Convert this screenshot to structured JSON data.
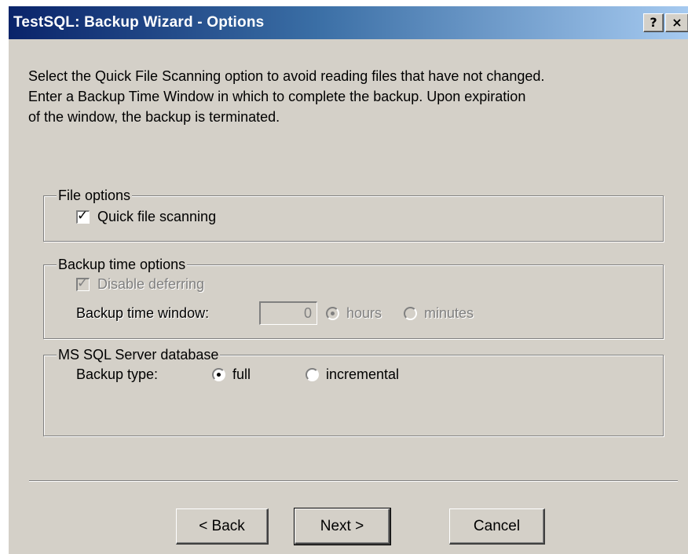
{
  "window": {
    "title": "TestSQL: Backup Wizard - Options",
    "help_glyph": "?",
    "close_glyph": "×"
  },
  "description": {
    "line1": "Select the Quick File Scanning option to avoid reading files that have not changed.",
    "line2": "Enter a Backup Time Window in which to complete the backup. Upon expiration",
    "line3": "of the window, the backup is terminated."
  },
  "file_options": {
    "legend": "File options",
    "quick_scan_label": "Quick file scanning",
    "quick_scan_checked": true
  },
  "backup_time_options": {
    "legend": "Backup time options",
    "disable_deferring_label": "Disable deferring",
    "disable_deferring_checked": true,
    "disabled": true,
    "window_label": "Backup time window:",
    "window_value": "0",
    "unit_hours_label": "hours",
    "unit_minutes_label": "minutes",
    "selected_unit": "hours"
  },
  "ms_sql": {
    "legend": "MS SQL Server database",
    "backup_type_label": "Backup type:",
    "full_label": "full",
    "incremental_label": "incremental",
    "selected_type": "full"
  },
  "buttons": {
    "back_label": "< Back",
    "next_label": "Next >",
    "cancel_label": "Cancel"
  },
  "colors": {
    "dialog_bg": "#d4d0c8",
    "title_start": "#0a246a",
    "title_end": "#a6caf0",
    "disabled_text": "#808080"
  }
}
